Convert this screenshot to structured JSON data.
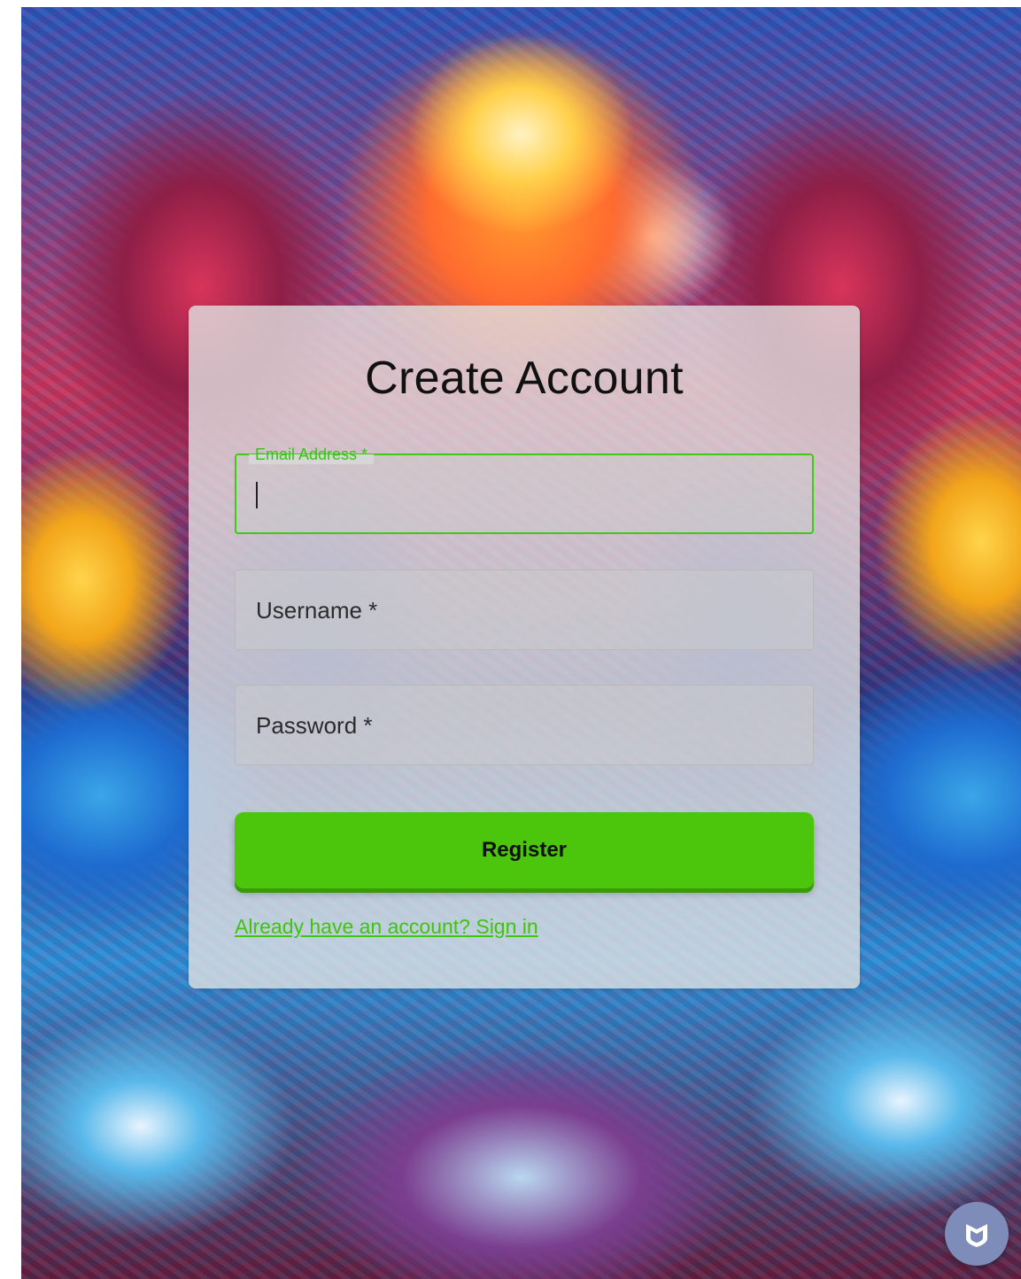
{
  "form": {
    "title": "Create Account",
    "email": {
      "label": "Email Address *",
      "value": ""
    },
    "username": {
      "label": "Username *",
      "value": ""
    },
    "password": {
      "label": "Password *",
      "value": ""
    },
    "register_label": "Register",
    "signin_link": "Already have an account? Sign in"
  },
  "colors": {
    "accent": "#4cc60c",
    "focus_border": "#3fca12",
    "link": "#3fc40f",
    "card_background": "#e1e1e1",
    "widget": "#7d8cb8"
  },
  "icons": {
    "help_widget": "shield-logo-icon"
  }
}
